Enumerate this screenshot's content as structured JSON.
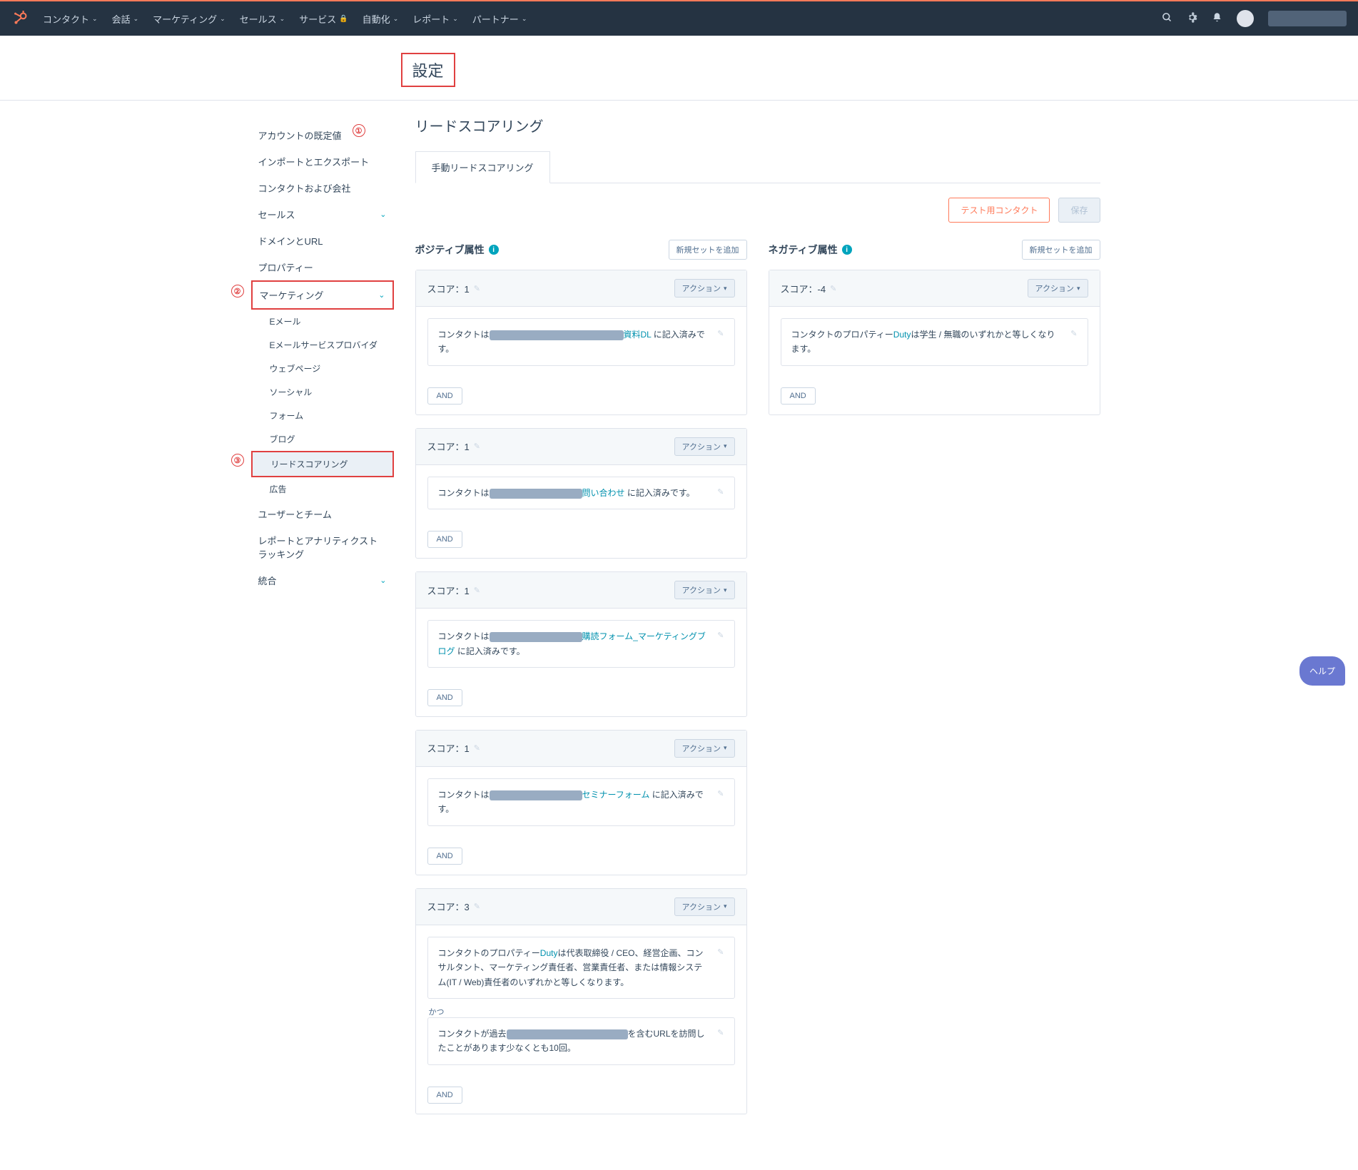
{
  "topnav": {
    "items": [
      {
        "label": "コンタクト",
        "caret": true
      },
      {
        "label": "会話",
        "caret": true
      },
      {
        "label": "マーケティング",
        "caret": true
      },
      {
        "label": "セールス",
        "caret": true
      },
      {
        "label": "サービス",
        "lock": true
      },
      {
        "label": "自動化",
        "caret": true
      },
      {
        "label": "レポート",
        "caret": true
      },
      {
        "label": "パートナー",
        "caret": true
      }
    ]
  },
  "page_title": "設定",
  "sidebar": {
    "items": [
      {
        "label": "アカウントの既定値"
      },
      {
        "label": "インポートとエクスポート"
      },
      {
        "label": "コンタクトおよび会社"
      },
      {
        "label": "セールス",
        "expandable": true
      },
      {
        "label": "ドメインとURL"
      },
      {
        "label": "プロパティー"
      }
    ],
    "marketing": {
      "label": "マーケティング",
      "expanded": true
    },
    "sub": [
      {
        "label": "Eメール"
      },
      {
        "label": "Eメールサービスプロバイダ"
      },
      {
        "label": "ウェブページ"
      },
      {
        "label": "ソーシャル"
      },
      {
        "label": "フォーム"
      },
      {
        "label": "ブログ"
      },
      {
        "label": "リードスコアリング",
        "active": true
      },
      {
        "label": "広告"
      }
    ],
    "after": [
      {
        "label": "ユーザーとチーム"
      },
      {
        "label": "レポートとアナリティクストラッキング"
      },
      {
        "label": "統合",
        "expandable": true
      }
    ]
  },
  "content": {
    "title": "リードスコアリング",
    "tab": "手動リードスコアリング",
    "test_contact_btn": "テスト用コンタクト",
    "save_btn": "保存",
    "positive": {
      "title": "ポジティブ属性",
      "add_btn": "新規セットを追加"
    },
    "negative": {
      "title": "ネガティブ属性",
      "add_btn": "新規セットを追加"
    },
    "action_label": "アクション",
    "and_label": "AND",
    "connector_and": "かつ",
    "positive_cards": [
      {
        "score": "スコア：1",
        "criteria": [
          {
            "prefix": "コンタクトは",
            "link": "資料DL",
            "suffix": " に記入済みです。",
            "redacted_w": 188
          }
        ]
      },
      {
        "score": "スコア：1",
        "criteria": [
          {
            "prefix": "コンタクトは",
            "link": "問い合わせ",
            "suffix": " に記入済みです。",
            "redacted_w": 130
          }
        ]
      },
      {
        "score": "スコア：1",
        "criteria": [
          {
            "prefix": "コンタクトは",
            "link": "購読フォーム_マーケティングブログ",
            "suffix": " に記入済みです。",
            "redacted_w": 130
          }
        ]
      },
      {
        "score": "スコア：1",
        "criteria": [
          {
            "prefix": "コンタクトは",
            "link": "セミナーフォーム",
            "suffix": " に記入済みです。",
            "redacted_w": 130
          }
        ]
      },
      {
        "score": "スコア：3",
        "criteria": [
          {
            "text": "コンタクトのプロパティーDutyは代表取締役 / CEO、経営企画、コンサルタント、マーケティング責任者、営業責任者、または情報システム(IT / Web)責任者のいずれかと等しくなります。",
            "link_inline": "Duty"
          },
          {
            "prefix": "コンタクトが過去",
            "suffix": "を含むURLを訪問したことがあります少なくとも10回。",
            "redacted_w": 170
          }
        ]
      }
    ],
    "negative_cards": [
      {
        "score": "スコア：-4",
        "criteria": [
          {
            "text": "コンタクトのプロパティーDutyは学生 / 無職のいずれかと等しくなります。",
            "link_inline": "Duty"
          }
        ]
      }
    ]
  },
  "annotations": {
    "a1": "①",
    "a2": "②",
    "a3": "③"
  },
  "help": "ヘルプ"
}
